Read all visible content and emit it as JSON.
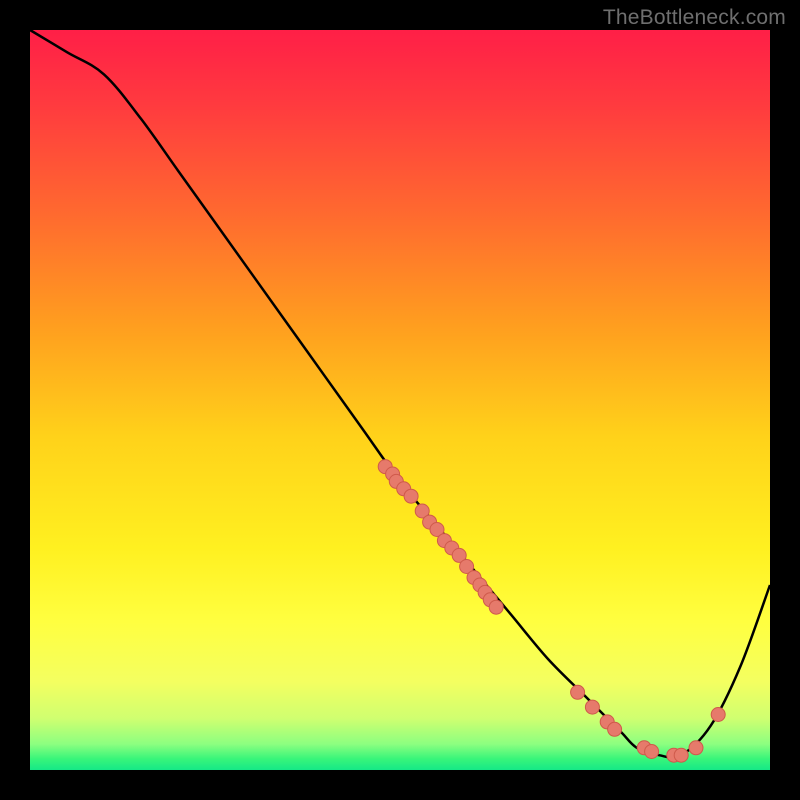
{
  "watermark": "TheBottleneck.com",
  "colors": {
    "frame": "#000000",
    "curve": "#000000",
    "marker_fill": "#e67a6b",
    "marker_stroke": "#cf5a4b"
  },
  "gradient_stops": [
    {
      "offset": 0.0,
      "color": "#ff1f47"
    },
    {
      "offset": 0.1,
      "color": "#ff3a3f"
    },
    {
      "offset": 0.25,
      "color": "#ff6a2f"
    },
    {
      "offset": 0.4,
      "color": "#ff9e1f"
    },
    {
      "offset": 0.55,
      "color": "#ffd21a"
    },
    {
      "offset": 0.7,
      "color": "#fff020"
    },
    {
      "offset": 0.8,
      "color": "#ffff40"
    },
    {
      "offset": 0.88,
      "color": "#f4ff60"
    },
    {
      "offset": 0.93,
      "color": "#d0ff70"
    },
    {
      "offset": 0.965,
      "color": "#8cff80"
    },
    {
      "offset": 0.985,
      "color": "#38f57a"
    },
    {
      "offset": 1.0,
      "color": "#15e887"
    }
  ],
  "chart_data": {
    "type": "line",
    "title": "",
    "xlabel": "",
    "ylabel": "",
    "xlim": [
      0,
      100
    ],
    "ylim": [
      0,
      100
    ],
    "grid": false,
    "curve": {
      "x": [
        0,
        5,
        10,
        15,
        20,
        25,
        30,
        35,
        40,
        45,
        50,
        55,
        60,
        65,
        70,
        75,
        78,
        80,
        82,
        85,
        88,
        92,
        96,
        100
      ],
      "y": [
        100,
        97,
        94,
        88,
        81,
        74,
        67,
        60,
        53,
        46,
        39,
        33,
        27,
        21,
        15,
        10,
        7,
        5,
        3,
        2,
        2,
        6,
        14,
        25
      ]
    },
    "scatter": [
      {
        "x": 48,
        "y": 41
      },
      {
        "x": 49,
        "y": 40
      },
      {
        "x": 49.5,
        "y": 39
      },
      {
        "x": 50.5,
        "y": 38
      },
      {
        "x": 51.5,
        "y": 37
      },
      {
        "x": 53,
        "y": 35
      },
      {
        "x": 54,
        "y": 33.5
      },
      {
        "x": 55,
        "y": 32.5
      },
      {
        "x": 56,
        "y": 31
      },
      {
        "x": 57,
        "y": 30
      },
      {
        "x": 58,
        "y": 29
      },
      {
        "x": 59,
        "y": 27.5
      },
      {
        "x": 60,
        "y": 26
      },
      {
        "x": 60.8,
        "y": 25
      },
      {
        "x": 61.5,
        "y": 24
      },
      {
        "x": 62.2,
        "y": 23
      },
      {
        "x": 63,
        "y": 22
      },
      {
        "x": 74,
        "y": 10.5
      },
      {
        "x": 76,
        "y": 8.5
      },
      {
        "x": 78,
        "y": 6.5
      },
      {
        "x": 79,
        "y": 5.5
      },
      {
        "x": 83,
        "y": 3
      },
      {
        "x": 84,
        "y": 2.5
      },
      {
        "x": 87,
        "y": 2
      },
      {
        "x": 88,
        "y": 2
      },
      {
        "x": 90,
        "y": 3
      },
      {
        "x": 93,
        "y": 7.5
      }
    ],
    "marker_radius": 7
  }
}
